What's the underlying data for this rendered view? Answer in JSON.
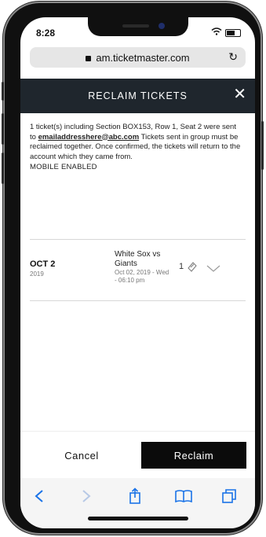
{
  "status": {
    "time": "8:28"
  },
  "browser": {
    "url": "am.ticketmaster.com"
  },
  "modal": {
    "title": "RECLAIM TICKETS",
    "message_prefix": "1 ticket(s) including Section BOX153, Row 1, Seat 2 were sent to",
    "email": "emailaddresshere@abc.com",
    "message_suffix": "Tickets sent in group must be reclaimed together. Once confirmed, the tickets will return to the account which they came from.",
    "mobile_label": "MOBILE ENABLED"
  },
  "ticket": {
    "date": "OCT 2",
    "year": "2019",
    "event_title": "White Sox vs Giants",
    "event_sub": "Oct 02, 2019 - Wed - 06:10 pm",
    "count": "1"
  },
  "actions": {
    "cancel": "Cancel",
    "reclaim": "Reclaim"
  },
  "colors": {
    "header_bg": "#1f262d",
    "reclaim_bg": "#0b0b0b",
    "accent": "#1a73e8"
  }
}
